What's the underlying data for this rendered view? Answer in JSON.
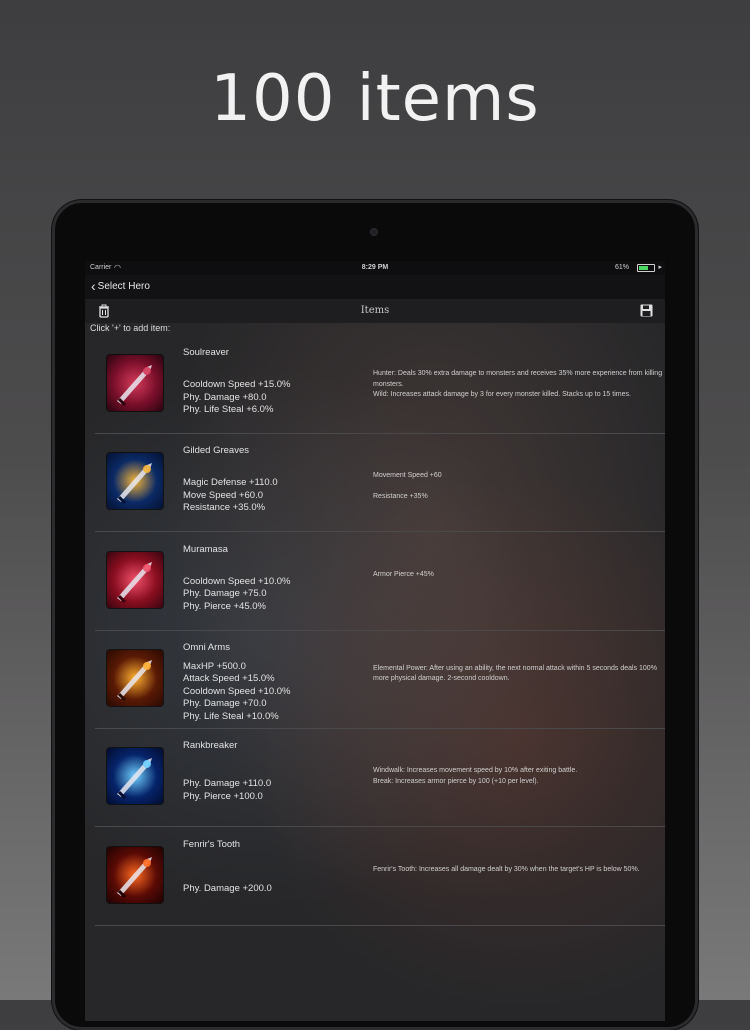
{
  "promo": {
    "title": "100 items"
  },
  "status_bar": {
    "carrier": "Carrier",
    "time": "8:29 PM",
    "battery": "61%"
  },
  "nav": {
    "back_label": "Select Hero"
  },
  "toolbar": {
    "title": "Items"
  },
  "hint": "Click '+' to add item:",
  "items": [
    {
      "name": "Soulreaver",
      "stats": [
        "Cooldown Speed +15.0%",
        "Phy. Damage +80.0",
        "Phy. Life Steal +6.0%"
      ],
      "passive": [
        "Hunter: Deals 30% extra damage to monsters and receives 35% more experience from killing monsters.",
        "Wild: Increases attack damage by 3 for every monster killed. Stacks up to 15 times."
      ],
      "icon": "soulreaver-icon",
      "colors": [
        "#7a0f2a",
        "#d43a5a",
        "#2a0510"
      ]
    },
    {
      "name": "Gilded Greaves",
      "stats": [
        "Magic Defense +110.0",
        "Move Speed +60.0",
        "Resistance +35.0%"
      ],
      "passive": [
        "Movement Speed +60",
        "Resistance +35%"
      ],
      "icon": "gilded-greaves-icon",
      "colors": [
        "#0b2a66",
        "#f2b23a",
        "#051233"
      ]
    },
    {
      "name": "Muramasa",
      "stats": [
        "Cooldown Speed +10.0%",
        "Phy. Damage +75.0",
        "Phy. Pierce +45.0%"
      ],
      "passive": [
        "Armor Pierce +45%"
      ],
      "icon": "muramasa-icon",
      "colors": [
        "#8a0e20",
        "#f0506a",
        "#3a0510"
      ]
    },
    {
      "name": "Omni Arms",
      "stats": [
        "MaxHP +500.0",
        "Attack Speed +15.0%",
        "Cooldown Speed +10.0%",
        "Phy. Damage +70.0",
        "Phy. Life Steal +10.0%"
      ],
      "passive": [
        "Elemental Power: After using an ability, the next normal attack within 5 seconds deals 100% more physical damage. 2-second cooldown."
      ],
      "icon": "omni-arms-icon",
      "colors": [
        "#5a1a05",
        "#ffb030",
        "#2a0a02"
      ]
    },
    {
      "name": "Rankbreaker",
      "stats": [
        "Phy. Damage +110.0",
        "Phy. Pierce +100.0"
      ],
      "passive": [
        "Windwalk: Increases movement speed by 10% after exiting battle.",
        "Break: Increases armor pierce by 100 (+10 per level)."
      ],
      "icon": "rankbreaker-icon",
      "colors": [
        "#06246a",
        "#6fd0ff",
        "#020c30"
      ]
    },
    {
      "name": "Fenrir's Tooth",
      "stats": [
        "Phy. Damage +200.0"
      ],
      "passive": [
        "Fenrir's Tooth: Increases all damage dealt by 30% when the target's HP is below 50%."
      ],
      "icon": "fenrirs-tooth-icon",
      "colors": [
        "#5a0a05",
        "#ff6a20",
        "#200302"
      ]
    }
  ]
}
